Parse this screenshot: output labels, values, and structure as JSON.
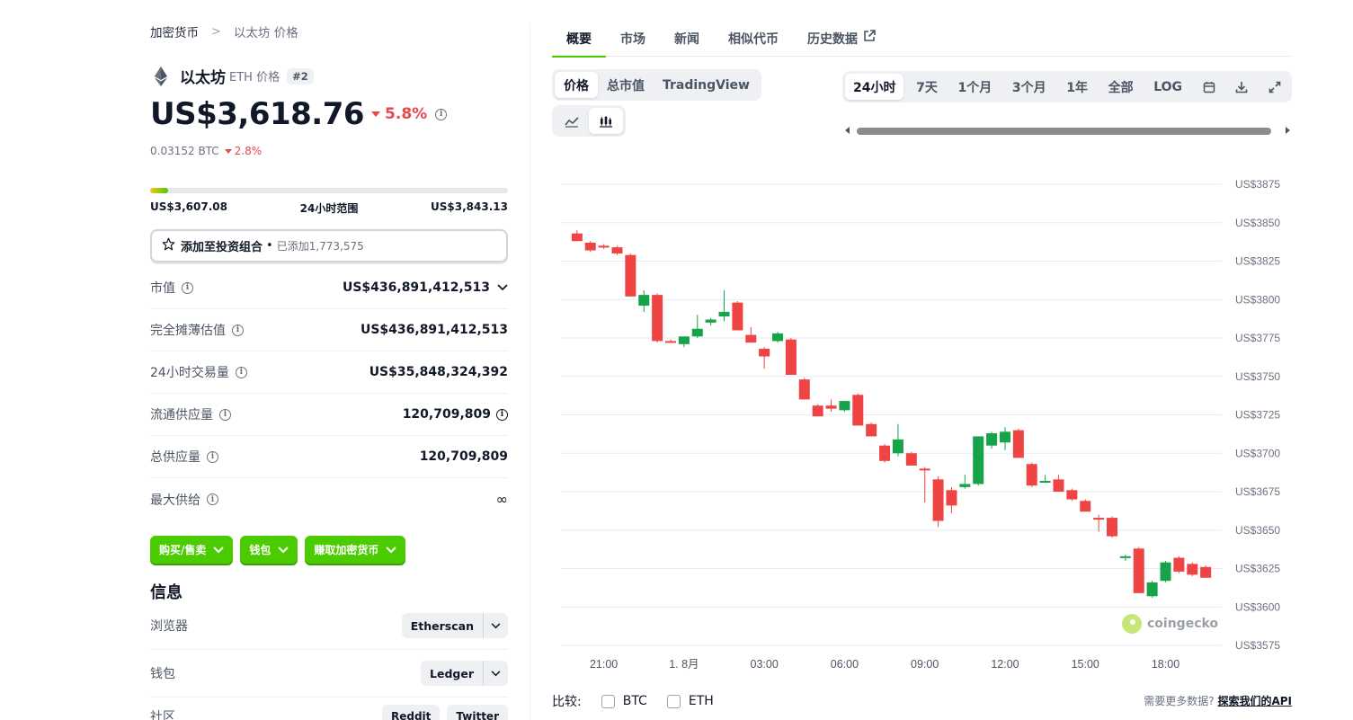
{
  "breadcrumb": {
    "root": "加密货币",
    "separator": ">",
    "current": "以太坊 价格"
  },
  "coin": {
    "name": "以太坊",
    "symbol_label": "ETH 价格",
    "rank": "#2"
  },
  "price": {
    "value": "US$3,618.76",
    "change": "5.8%",
    "btc_value": "0.03152 BTC",
    "btc_change": "2.8%"
  },
  "range_24h": {
    "low": "US$3,607.08",
    "label": "24小时范围",
    "high": "US$3,843.13",
    "position_fraction": 0.05
  },
  "portfolio": {
    "label": "添加至投资组合",
    "dot": "•",
    "added": "已添加1,773,575"
  },
  "stats": [
    {
      "label": "市值",
      "value": "US$436,891,412,513"
    },
    {
      "label": "完全摊薄估值",
      "value": "US$436,891,412,513"
    },
    {
      "label": "24小时交易量",
      "value": "US$35,848,324,392"
    },
    {
      "label": "流通供应量",
      "value": "120,709,809"
    },
    {
      "label": "总供应量",
      "value": "120,709,809"
    },
    {
      "label": "最大供给",
      "value": "∞"
    }
  ],
  "actions": {
    "buy_sell": "购买/售卖",
    "wallet": "钱包",
    "earn": "赚取加密货币"
  },
  "info": {
    "title": "信息",
    "explorer_label": "浏览器",
    "explorer_value": "Etherscan",
    "wallet_label": "钱包",
    "wallet_value": "Ledger",
    "community_label": "社区",
    "community_1": "Reddit",
    "community_2": "Twitter"
  },
  "tabs": [
    "概要",
    "市场",
    "新闻",
    "相似代币",
    "历史数据"
  ],
  "chart_controls": {
    "type_options": [
      "价格",
      "总市值",
      "TradingView"
    ],
    "range_options": [
      "24小时",
      "7天",
      "1个月",
      "3个月",
      "1年",
      "全部",
      "LOG"
    ]
  },
  "compare": {
    "label": "比较:",
    "btc": "BTC",
    "eth": "ETH"
  },
  "api_note": {
    "text": "需要更多数据?",
    "link": "探索我们的API"
  },
  "watermark": "coingecko",
  "colors": {
    "accent": "#4bcc00",
    "down": "#e5484d",
    "candle_up": "#16a34a",
    "candle_down": "#ef4444"
  },
  "chart_data": {
    "type": "candlestick",
    "y_axis": {
      "prefix": "US$",
      "ticks": [
        3875,
        3850,
        3825,
        3800,
        3775,
        3750,
        3725,
        3700,
        3675,
        3650,
        3625,
        3600,
        3575
      ],
      "range": [
        3575,
        3875
      ]
    },
    "x_axis": {
      "ticks": [
        {
          "label": "21:00",
          "hour": 1
        },
        {
          "label": "1. 8月",
          "hour": 4
        },
        {
          "label": "03:00",
          "hour": 7
        },
        {
          "label": "06:00",
          "hour": 10
        },
        {
          "label": "09:00",
          "hour": 13
        },
        {
          "label": "12:00",
          "hour": 16
        },
        {
          "label": "15:00",
          "hour": 19
        },
        {
          "label": "18:00",
          "hour": 22
        }
      ]
    },
    "candles": [
      {
        "t": 0,
        "o": 3843,
        "h": 3845,
        "l": 3838,
        "c": 3838
      },
      {
        "t": 0.5,
        "o": 3837,
        "h": 3838,
        "l": 3831,
        "c": 3832
      },
      {
        "t": 1,
        "o": 3835,
        "h": 3836,
        "l": 3833,
        "c": 3834
      },
      {
        "t": 1.5,
        "o": 3834,
        "h": 3835,
        "l": 3829,
        "c": 3830
      },
      {
        "t": 2,
        "o": 3829,
        "h": 3830,
        "l": 3802,
        "c": 3802
      },
      {
        "t": 2.5,
        "o": 3796,
        "h": 3806,
        "l": 3792,
        "c": 3803
      },
      {
        "t": 3,
        "o": 3803,
        "h": 3804,
        "l": 3772,
        "c": 3773
      },
      {
        "t": 3.5,
        "o": 3773,
        "h": 3774,
        "l": 3772,
        "c": 3772
      },
      {
        "t": 4,
        "o": 3771,
        "h": 3776,
        "l": 3769,
        "c": 3776
      },
      {
        "t": 4.5,
        "o": 3776,
        "h": 3790,
        "l": 3775,
        "c": 3781
      },
      {
        "t": 5,
        "o": 3785,
        "h": 3788,
        "l": 3783,
        "c": 3787
      },
      {
        "t": 5.5,
        "o": 3789,
        "h": 3806,
        "l": 3786,
        "c": 3792
      },
      {
        "t": 6,
        "o": 3798,
        "h": 3799,
        "l": 3780,
        "c": 3780
      },
      {
        "t": 6.5,
        "o": 3777,
        "h": 3782,
        "l": 3772,
        "c": 3772
      },
      {
        "t": 7,
        "o": 3768,
        "h": 3769,
        "l": 3755,
        "c": 3763
      },
      {
        "t": 7.5,
        "o": 3773,
        "h": 3779,
        "l": 3772,
        "c": 3778
      },
      {
        "t": 8,
        "o": 3774,
        "h": 3775,
        "l": 3751,
        "c": 3751
      },
      {
        "t": 8.5,
        "o": 3748,
        "h": 3749,
        "l": 3735,
        "c": 3735
      },
      {
        "t": 9,
        "o": 3731,
        "h": 3732,
        "l": 3725,
        "c": 3724
      },
      {
        "t": 9.5,
        "o": 3731,
        "h": 3735,
        "l": 3727,
        "c": 3729
      },
      {
        "t": 10,
        "o": 3728,
        "h": 3734,
        "l": 3727,
        "c": 3734
      },
      {
        "t": 10.5,
        "o": 3738,
        "h": 3739,
        "l": 3718,
        "c": 3718
      },
      {
        "t": 11,
        "o": 3719,
        "h": 3720,
        "l": 3711,
        "c": 3711
      },
      {
        "t": 11.5,
        "o": 3705,
        "h": 3706,
        "l": 3694,
        "c": 3695
      },
      {
        "t": 12,
        "o": 3700,
        "h": 3719,
        "l": 3698,
        "c": 3709
      },
      {
        "t": 12.5,
        "o": 3700,
        "h": 3701,
        "l": 3692,
        "c": 3692
      },
      {
        "t": 13,
        "o": 3690,
        "h": 3691,
        "l": 3668,
        "c": 3689
      },
      {
        "t": 13.5,
        "o": 3683,
        "h": 3685,
        "l": 3652,
        "c": 3656
      },
      {
        "t": 14,
        "o": 3676,
        "h": 3678,
        "l": 3661,
        "c": 3666
      },
      {
        "t": 14.5,
        "o": 3678,
        "h": 3686,
        "l": 3677,
        "c": 3680
      },
      {
        "t": 15,
        "o": 3680,
        "h": 3711,
        "l": 3679,
        "c": 3711
      },
      {
        "t": 15.5,
        "o": 3705,
        "h": 3714,
        "l": 3703,
        "c": 3713
      },
      {
        "t": 16,
        "o": 3707,
        "h": 3717,
        "l": 3702,
        "c": 3714
      },
      {
        "t": 16.5,
        "o": 3715,
        "h": 3716,
        "l": 3697,
        "c": 3697
      },
      {
        "t": 17,
        "o": 3693,
        "h": 3694,
        "l": 3678,
        "c": 3679
      },
      {
        "t": 17.5,
        "o": 3682,
        "h": 3686,
        "l": 3681,
        "c": 3682
      },
      {
        "t": 18,
        "o": 3683,
        "h": 3686,
        "l": 3675,
        "c": 3675
      },
      {
        "t": 18.5,
        "o": 3676,
        "h": 3677,
        "l": 3669,
        "c": 3670
      },
      {
        "t": 19,
        "o": 3669,
        "h": 3670,
        "l": 3662,
        "c": 3662
      },
      {
        "t": 19.5,
        "o": 3658,
        "h": 3660,
        "l": 3649,
        "c": 3657
      },
      {
        "t": 20,
        "o": 3658,
        "h": 3659,
        "l": 3645,
        "c": 3646
      },
      {
        "t": 20.5,
        "o": 3632,
        "h": 3634,
        "l": 3630,
        "c": 3633
      },
      {
        "t": 21,
        "o": 3638,
        "h": 3639,
        "l": 3609,
        "c": 3609
      },
      {
        "t": 21.5,
        "o": 3607,
        "h": 3617,
        "l": 3606,
        "c": 3616
      },
      {
        "t": 22,
        "o": 3617,
        "h": 3630,
        "l": 3616,
        "c": 3629
      },
      {
        "t": 22.5,
        "o": 3632,
        "h": 3633,
        "l": 3622,
        "c": 3623
      },
      {
        "t": 23,
        "o": 3628,
        "h": 3629,
        "l": 3620,
        "c": 3621
      },
      {
        "t": 23.5,
        "o": 3626,
        "h": 3627,
        "l": 3619,
        "c": 3619
      }
    ]
  }
}
